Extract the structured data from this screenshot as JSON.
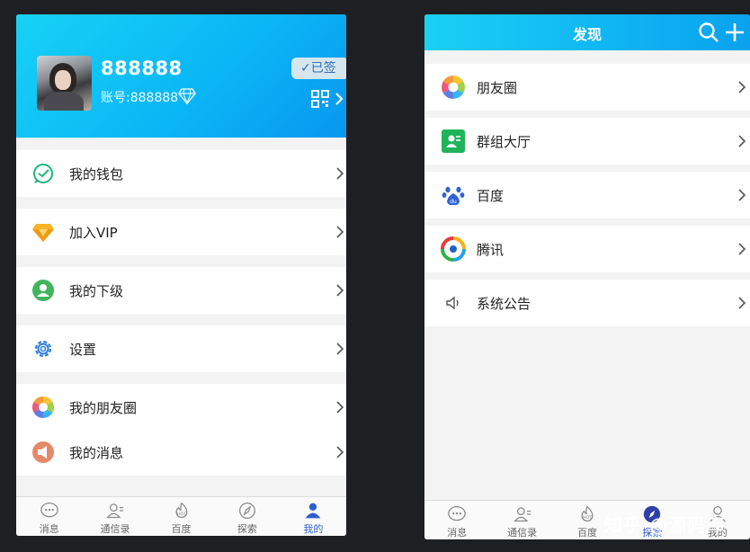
{
  "profile": {
    "username": "888888",
    "account": "账号:888888",
    "signed_label": "✓已签"
  },
  "my_menu": [
    {
      "label": "我的钱包",
      "icon": "wallet-icon"
    },
    {
      "label": "加入VIP",
      "icon": "vip-diamond-icon"
    },
    {
      "label": "我的下级",
      "icon": "subordinate-user-icon"
    },
    {
      "label": "设置",
      "icon": "gear-icon"
    },
    {
      "label": "我的朋友圈",
      "icon": "moments-aperture-icon"
    },
    {
      "label": "我的消息",
      "icon": "message-megaphone-icon"
    }
  ],
  "left_tabbar": [
    {
      "label": "消息",
      "icon": "chat-bubble-icon"
    },
    {
      "label": "通信录",
      "icon": "contacts-icon"
    },
    {
      "label": "百度",
      "icon": "hot-icon"
    },
    {
      "label": "探索",
      "icon": "compass-icon"
    },
    {
      "label": "我的",
      "icon": "person-icon",
      "active": true
    }
  ],
  "discover": {
    "title": "发现",
    "items": [
      {
        "label": "朋友圈",
        "icon": "moments-aperture-icon"
      },
      {
        "label": "群组大厅",
        "icon": "group-hall-icon"
      },
      {
        "label": "百度",
        "icon": "baidu-paw-icon"
      },
      {
        "label": "腾讯",
        "icon": "tencent-icon"
      },
      {
        "label": "系统公告",
        "icon": "speaker-icon"
      }
    ]
  },
  "right_tabbar": [
    {
      "label": "消息",
      "icon": "chat-bubble-icon"
    },
    {
      "label": "通信录",
      "icon": "contacts-icon"
    },
    {
      "label": "百度",
      "icon": "hot-icon"
    },
    {
      "label": "探索",
      "icon": "compass-icon",
      "active": true
    },
    {
      "label": "我的",
      "icon": "person-icon"
    }
  ],
  "watermark": "知乎 @源码库",
  "colors": {
    "header_gradient_start": "#16d2f5",
    "header_gradient_end": "#0897f0",
    "active_tab": "#2f5fcf"
  }
}
